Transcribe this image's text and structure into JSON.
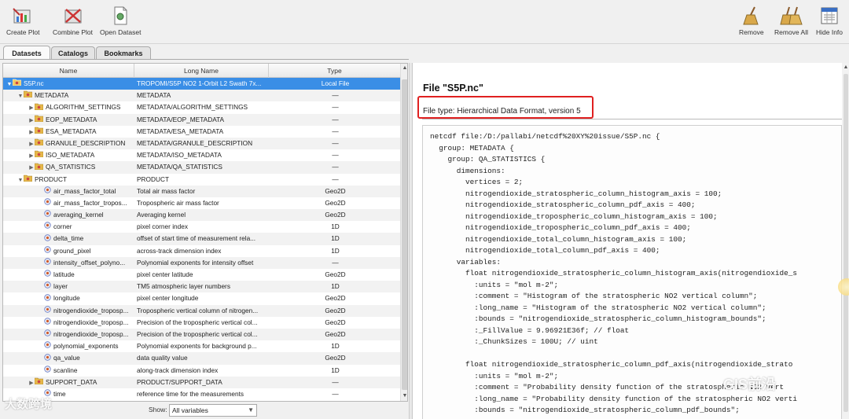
{
  "toolbar": {
    "create_plot": "Create Plot",
    "combine_plot": "Combine Plot",
    "open_dataset": "Open Dataset",
    "remove": "Remove",
    "remove_all": "Remove All",
    "hide_info": "Hide Info"
  },
  "tabs": [
    "Datasets",
    "Catalogs",
    "Bookmarks"
  ],
  "columns": {
    "name": "Name",
    "long_name": "Long Name",
    "type": "Type"
  },
  "rows": [
    {
      "indent": 0,
      "tw": "▼",
      "icon": "file",
      "name": "S5P.nc",
      "long": "TROPOMI/S5P NO2 1-Orbit L2 Swath 7x...",
      "type": "Local File",
      "sel": true
    },
    {
      "indent": 1,
      "tw": "▼",
      "icon": "folder",
      "name": "METADATA",
      "long": "METADATA",
      "type": "—"
    },
    {
      "indent": 2,
      "tw": "▶",
      "icon": "folder",
      "name": "ALGORITHM_SETTINGS",
      "long": "METADATA/ALGORITHM_SETTINGS",
      "type": "—"
    },
    {
      "indent": 2,
      "tw": "▶",
      "icon": "folder",
      "name": "EOP_METADATA",
      "long": "METADATA/EOP_METADATA",
      "type": "—"
    },
    {
      "indent": 2,
      "tw": "▶",
      "icon": "folder",
      "name": "ESA_METADATA",
      "long": "METADATA/ESA_METADATA",
      "type": "—"
    },
    {
      "indent": 2,
      "tw": "▶",
      "icon": "folder",
      "name": "GRANULE_DESCRIPTION",
      "long": "METADATA/GRANULE_DESCRIPTION",
      "type": "—"
    },
    {
      "indent": 2,
      "tw": "▶",
      "icon": "folder",
      "name": "ISO_METADATA",
      "long": "METADATA/ISO_METADATA",
      "type": "—"
    },
    {
      "indent": 2,
      "tw": "▶",
      "icon": "folder",
      "name": "QA_STATISTICS",
      "long": "METADATA/QA_STATISTICS",
      "type": "—"
    },
    {
      "indent": 1,
      "tw": "▼",
      "icon": "folder",
      "name": "PRODUCT",
      "long": "PRODUCT",
      "type": "—"
    },
    {
      "indent": 3,
      "tw": "",
      "icon": "var",
      "name": "air_mass_factor_total",
      "long": "Total air mass factor",
      "type": "Geo2D"
    },
    {
      "indent": 3,
      "tw": "",
      "icon": "var",
      "name": "air_mass_factor_tropos...",
      "long": "Tropospheric air mass factor",
      "type": "Geo2D"
    },
    {
      "indent": 3,
      "tw": "",
      "icon": "var",
      "name": "averaging_kernel",
      "long": "Averaging kernel",
      "type": "Geo2D"
    },
    {
      "indent": 3,
      "tw": "",
      "icon": "var",
      "name": "corner",
      "long": "pixel corner index",
      "type": "1D"
    },
    {
      "indent": 3,
      "tw": "",
      "icon": "var",
      "name": "delta_time",
      "long": "offset of start time of measurement rela...",
      "type": "1D"
    },
    {
      "indent": 3,
      "tw": "",
      "icon": "var",
      "name": "ground_pixel",
      "long": "across-track dimension index",
      "type": "1D"
    },
    {
      "indent": 3,
      "tw": "",
      "icon": "var",
      "name": "intensity_offset_polyno...",
      "long": "Polynomial exponents for intensity offset",
      "type": "—"
    },
    {
      "indent": 3,
      "tw": "",
      "icon": "var",
      "name": "latitude",
      "long": "pixel center latitude",
      "type": "Geo2D"
    },
    {
      "indent": 3,
      "tw": "",
      "icon": "var",
      "name": "layer",
      "long": "TM5 atmospheric layer numbers",
      "type": "1D"
    },
    {
      "indent": 3,
      "tw": "",
      "icon": "var",
      "name": "longitude",
      "long": "pixel center longitude",
      "type": "Geo2D"
    },
    {
      "indent": 3,
      "tw": "",
      "icon": "var",
      "name": "nitrogendioxide_troposp...",
      "long": "Tropospheric vertical column of nitrogen...",
      "type": "Geo2D"
    },
    {
      "indent": 3,
      "tw": "",
      "icon": "var",
      "name": "nitrogendioxide_troposp...",
      "long": "Precision of the tropospheric vertical col...",
      "type": "Geo2D"
    },
    {
      "indent": 3,
      "tw": "",
      "icon": "var",
      "name": "nitrogendioxide_troposp...",
      "long": "Precision of the tropospheric vertical col...",
      "type": "Geo2D"
    },
    {
      "indent": 3,
      "tw": "",
      "icon": "var",
      "name": "polynomial_exponents",
      "long": "Polynomial exponents for background p...",
      "type": "1D"
    },
    {
      "indent": 3,
      "tw": "",
      "icon": "var",
      "name": "qa_value",
      "long": "data quality value",
      "type": "Geo2D"
    },
    {
      "indent": 3,
      "tw": "",
      "icon": "var",
      "name": "scanline",
      "long": "along-track dimension index",
      "type": "1D"
    },
    {
      "indent": 2,
      "tw": "▶",
      "icon": "folder",
      "name": "SUPPORT_DATA",
      "long": "PRODUCT/SUPPORT_DATA",
      "type": "—"
    },
    {
      "indent": 3,
      "tw": "",
      "icon": "var",
      "name": "time",
      "long": "reference time for the measurements",
      "type": "—"
    }
  ],
  "show": {
    "label": "Show:",
    "value": "All variables"
  },
  "info": {
    "title": "File \"S5P.nc\"",
    "file_type": "File type: Hierarchical Data Format, version 5",
    "code": "netcdf file:/D:/pallabi/netcdf%20XY%20issue/S5P.nc {\n  group: METADATA {\n    group: QA_STATISTICS {\n      dimensions:\n        vertices = 2;\n        nitrogendioxide_stratospheric_column_histogram_axis = 100;\n        nitrogendioxide_stratospheric_column_pdf_axis = 400;\n        nitrogendioxide_tropospheric_column_histogram_axis = 100;\n        nitrogendioxide_tropospheric_column_pdf_axis = 400;\n        nitrogendioxide_total_column_histogram_axis = 100;\n        nitrogendioxide_total_column_pdf_axis = 400;\n      variables:\n        float nitrogendioxide_stratospheric_column_histogram_axis(nitrogendioxide_s\n          :units = \"mol m-2\";\n          :comment = \"Histogram of the stratospheric NO2 vertical column\";\n          :long_name = \"Histogram of the stratospheric NO2 vertical column\";\n          :bounds = \"nitrogendioxide_stratospheric_column_histogram_bounds\";\n          :_FillValue = 9.96921E36f; // float\n          :_ChunkSizes = 100U; // uint\n\n        float nitrogendioxide_stratospheric_column_pdf_axis(nitrogendioxide_strato\n          :units = \"mol m-2\";\n          :comment = \"Probability density function of the stratospheric NO2 vert\n          :long_name = \"Probability density function of the stratospheric NO2 verti\n          :bounds = \"nitrogendioxide_stratospheric_column_pdf_bounds\";"
  },
  "watermarks": [
    "大数跨境",
    "GIS前沿"
  ]
}
